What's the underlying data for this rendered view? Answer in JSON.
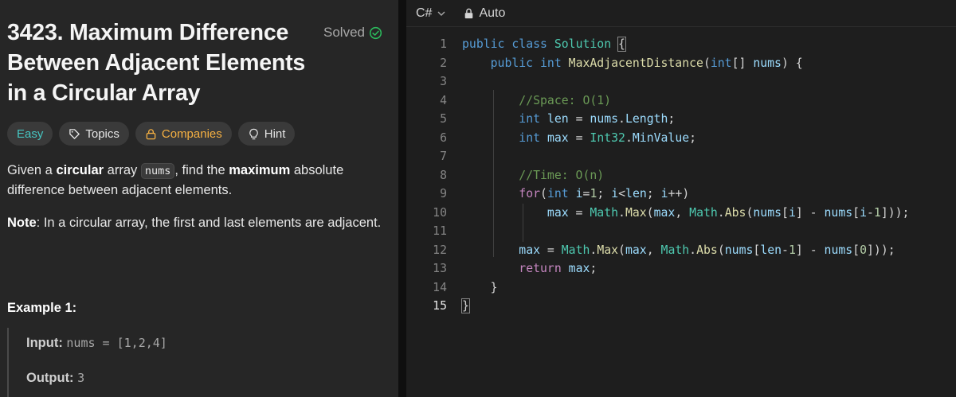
{
  "problem": {
    "title": "3423. Maximum Difference Between Adjacent Elements in a Circular Array",
    "status": "Solved",
    "tags": {
      "difficulty": "Easy",
      "topics": "Topics",
      "companies": "Companies",
      "hint": "Hint"
    },
    "description": {
      "p1_a": "Given a ",
      "p1_b": "circular",
      "p1_c": " array ",
      "p1_code": "nums",
      "p1_d": ", find the ",
      "p1_e": "maximum",
      "p1_f": " absolute difference between adjacent elements.",
      "note_label": "Note",
      "note_text": ": In a circular array, the first and last elements are adjacent."
    },
    "example": {
      "title": "Example 1:",
      "input_label": "Input:",
      "input_value": "nums = [1,2,4]",
      "output_label": "Output:",
      "output_value": "3"
    }
  },
  "editor": {
    "language": "C#",
    "mode": "Auto",
    "active_line": 15,
    "line_numbers": [
      "1",
      "2",
      "3",
      "4",
      "5",
      "6",
      "7",
      "8",
      "9",
      "10",
      "11",
      "12",
      "13",
      "14",
      "15"
    ]
  },
  "colors": {
    "easy": "#46c6c2",
    "companies": "#f5b042",
    "solved_check": "#2cbb5d"
  }
}
